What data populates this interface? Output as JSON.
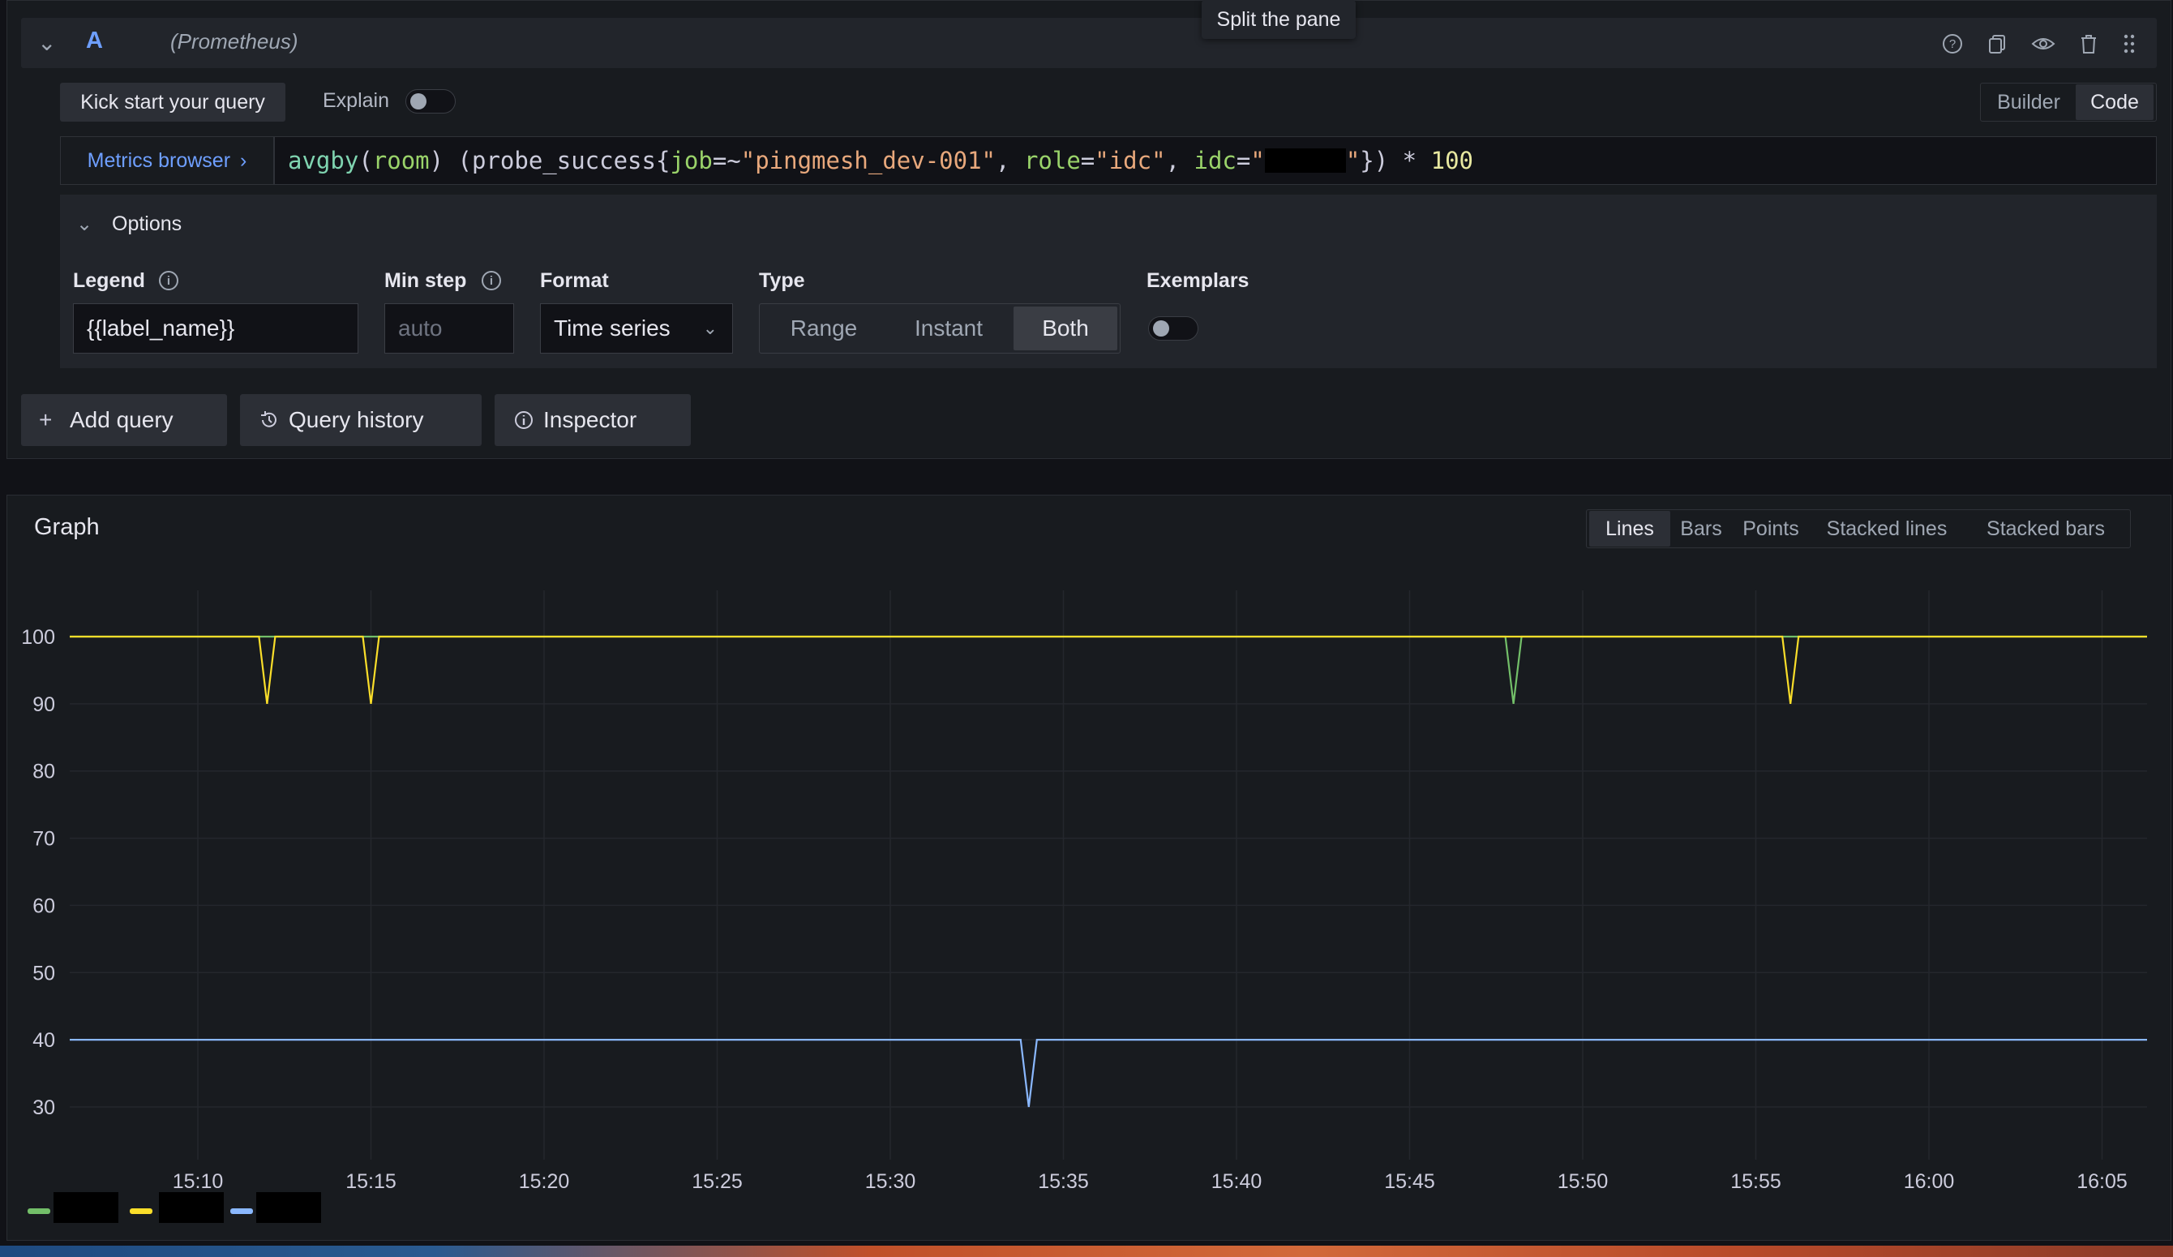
{
  "tooltip": "Split the pane",
  "query": {
    "collapse_icon": "chevron-down-icon",
    "ref_id": "A",
    "datasource": "(Prometheus)",
    "header_icons": [
      "help-icon",
      "duplicate-icon",
      "eye-icon",
      "trash-icon",
      "drag-handle-icon"
    ],
    "kick_start": "Kick start your query",
    "explain_label": "Explain",
    "explain_on": false,
    "modes": [
      "Builder",
      "Code"
    ],
    "active_mode": "Code",
    "metrics_browser": "Metrics browser",
    "code": {
      "p1": "avg",
      "p2": "by",
      "p3": "(",
      "p4": "room",
      "p5": ") (probe_success{",
      "p6": "job",
      "p7": "=~",
      "p8": "\"pingmesh_dev-001\"",
      "p9": ", ",
      "p10": "role",
      "p11": "=",
      "p12": "\"idc\"",
      "p13": ", ",
      "p14": "idc",
      "p15": "=",
      "p16": "\"",
      "p17": "\"",
      "p18": "}) * ",
      "p19": "100"
    }
  },
  "options": {
    "title": "Options",
    "legend_label": "Legend",
    "legend_value": "{{label_name}}",
    "min_step_label": "Min step",
    "min_step_placeholder": "auto",
    "format_label": "Format",
    "format_value": "Time series",
    "type_label": "Type",
    "types": [
      "Range",
      "Instant",
      "Both"
    ],
    "active_type": "Both",
    "exemplars_label": "Exemplars",
    "exemplars_on": false
  },
  "actions": {
    "add_query": "Add query",
    "query_history": "Query history",
    "inspector": "Inspector"
  },
  "graph": {
    "title": "Graph",
    "vis_modes": [
      "Lines",
      "Bars",
      "Points",
      "Stacked lines",
      "Stacked bars"
    ],
    "active_vis": "Lines"
  },
  "chart_data": {
    "type": "line",
    "x_ticks": [
      "15:10",
      "15:15",
      "15:20",
      "15:25",
      "15:30",
      "15:35",
      "15:40",
      "15:45",
      "15:50",
      "15:55",
      "16:00",
      "16:05"
    ],
    "y_ticks": [
      100,
      90,
      80,
      70,
      60,
      50,
      40,
      30
    ],
    "ylim": [
      24,
      107
    ],
    "grid": true,
    "x": [
      "15:06",
      "15:12",
      "15:15",
      "15:34",
      "15:48",
      "15:56",
      "16:06"
    ],
    "series": [
      {
        "color": "#73bf69",
        "values": [
          100,
          100,
          100,
          100,
          90,
          100,
          100
        ]
      },
      {
        "color": "#fade2a",
        "values": [
          100,
          90,
          90,
          100,
          100,
          90,
          100
        ]
      },
      {
        "color": "#8ab8ff",
        "values": [
          40,
          40,
          40,
          30,
          40,
          40,
          40
        ]
      }
    ],
    "legend_colors": [
      "#73bf69",
      "#fade2a",
      "#8ab8ff"
    ]
  }
}
